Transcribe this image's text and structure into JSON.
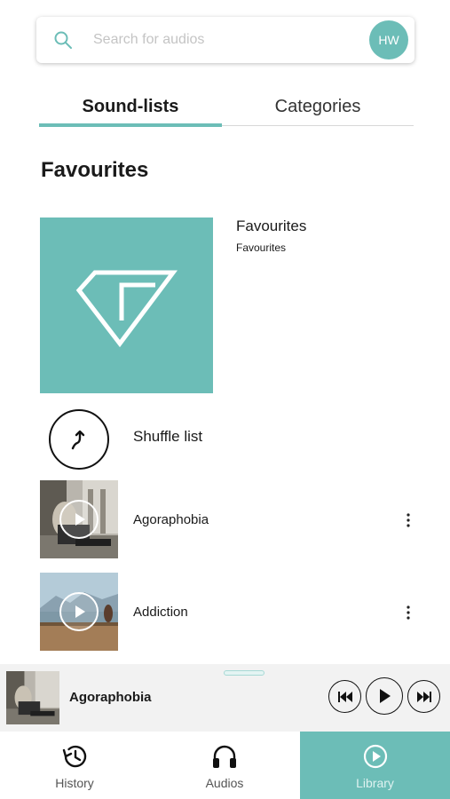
{
  "search": {
    "placeholder": "Search for audios",
    "avatar_text": "HW"
  },
  "tabs": [
    {
      "label": "Sound-lists",
      "active": true
    },
    {
      "label": "Categories",
      "active": false
    }
  ],
  "section_title": "Favourites",
  "playlist": {
    "name": "Favourites",
    "subtitle": "Favourites",
    "cover_icon": "diamond-logo-icon"
  },
  "shuffle": {
    "label": "Shuffle list",
    "icon": "shuffle-icon"
  },
  "tracks": [
    {
      "title": "Agoraphobia",
      "icon": "play-icon",
      "menu_icon": "more-vertical-icon"
    },
    {
      "title": "Addiction",
      "icon": "play-icon",
      "menu_icon": "more-vertical-icon"
    }
  ],
  "now_playing": {
    "title": "Agoraphobia",
    "controls": [
      "skip-previous-icon",
      "play-icon",
      "skip-next-icon"
    ]
  },
  "bottom_nav": [
    {
      "label": "History",
      "icon": "history-icon",
      "active": false
    },
    {
      "label": "Audios",
      "icon": "headphones-icon",
      "active": false
    },
    {
      "label": "Library",
      "icon": "play-circle-icon",
      "active": true
    }
  ],
  "colors": {
    "accent": "#6cbdb7",
    "mini_player_bg": "#f2f2f2"
  }
}
